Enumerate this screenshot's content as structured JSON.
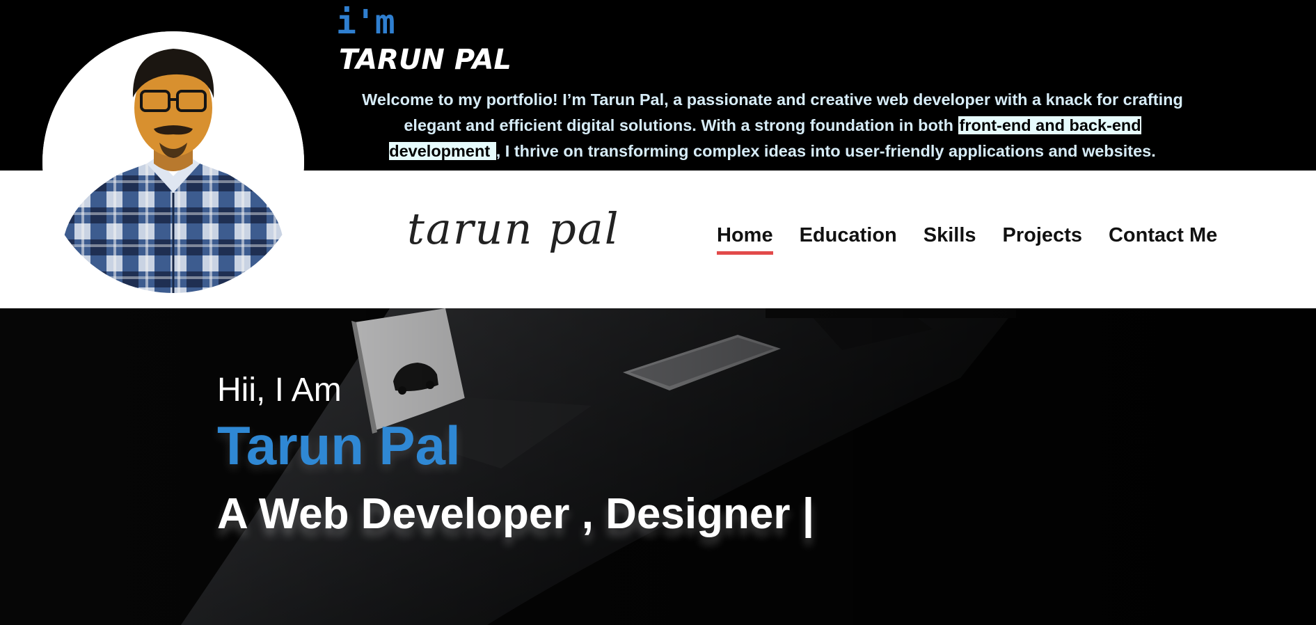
{
  "intro": {
    "im": "i'm",
    "name": "TARUN PAL",
    "welcome_part1": "Welcome to my portfolio! I’m Tarun Pal, a passionate and creative web developer with a knack for crafting elegant and efficient digital solutions. With a strong foundation in both ",
    "welcome_highlight": "front-end and back-end development ",
    "welcome_part2": ", I thrive on transforming complex ideas into user-friendly applications and websites."
  },
  "nav": {
    "logo": "tarun pal",
    "links": [
      "Home",
      "Education",
      "Skills",
      "Projects",
      "Contact Me"
    ],
    "active": "Home"
  },
  "hero": {
    "greeting": "Hii, I Am",
    "name": "Tarun Pal",
    "role": "A Web Developer , Designer |"
  },
  "colors": {
    "accent_blue": "#2f88d4",
    "active_underline": "#e24a4a",
    "highlight_bg": "#e6fbfc"
  }
}
